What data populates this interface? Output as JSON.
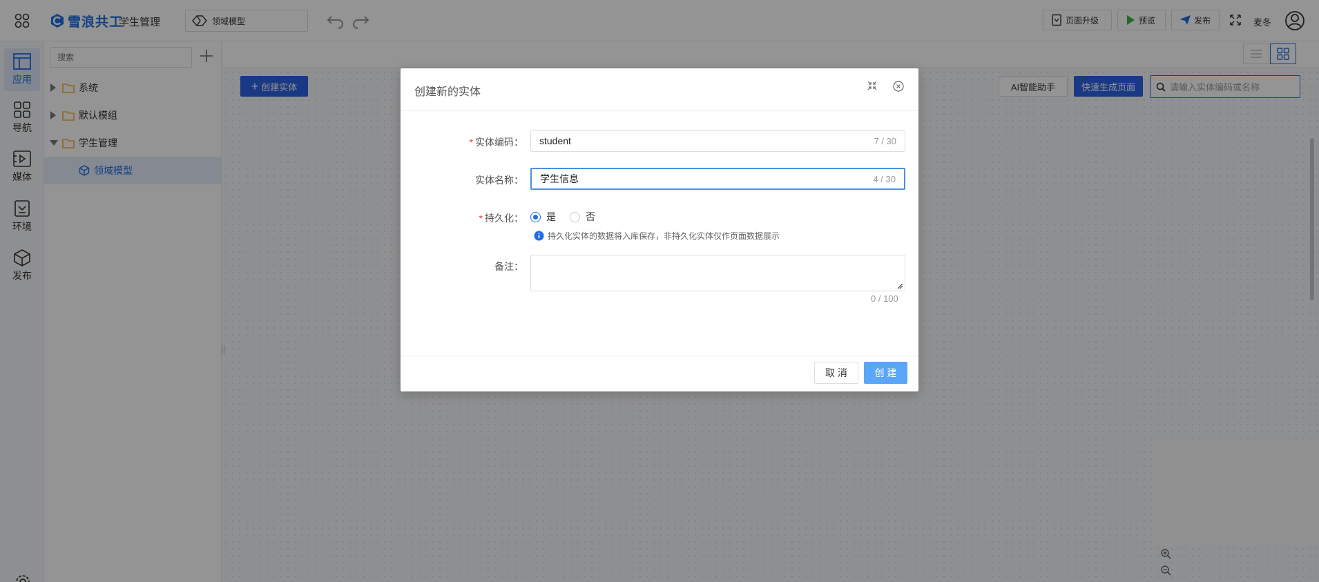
{
  "header": {
    "brand": "雪浪共工",
    "app_name": "学生管理",
    "model_selector": "领域模型",
    "upgrade_label": "页面升级",
    "preview_label": "预览",
    "publish_label": "发布",
    "user_name": "麦冬"
  },
  "leftnav": {
    "items": [
      {
        "label": "应用",
        "icon": "layout-icon"
      },
      {
        "label": "导航",
        "icon": "grid-icon"
      },
      {
        "label": "媒体",
        "icon": "media-icon"
      },
      {
        "label": "环境",
        "icon": "environment-icon"
      },
      {
        "label": "发布",
        "icon": "cube-icon"
      }
    ]
  },
  "tree": {
    "search_placeholder": "搜索",
    "items": [
      {
        "label": "系统"
      },
      {
        "label": "默认模组"
      },
      {
        "label": "学生管理"
      },
      {
        "label": "领域模型"
      }
    ]
  },
  "canvas": {
    "create_entity_label": "创建实体",
    "ai_assistant_label": "AI智能助手",
    "quick_generate_label": "快速生成页面",
    "search_placeholder": "请输入实体编码或名称"
  },
  "modal": {
    "title": "创建新的实体",
    "code_label": "实体编码",
    "code_value": "student",
    "code_count": "7 / 30",
    "name_label": "实体名称",
    "name_value": "学生信息",
    "name_count": "4 / 30",
    "persist_label": "持久化",
    "persist_yes": "是",
    "persist_no": "否",
    "persist_hint": "持久化实体的数据将入库保存，非持久化实体仅作页面数据展示",
    "remark_label": "备注",
    "remark_value": "",
    "remark_count": "0 / 100",
    "cancel_label": "取 消",
    "create_label": "创 建"
  },
  "colors": {
    "primary": "#2d62e3",
    "accent": "#1e6fe0",
    "create_button": "#5aa6f8",
    "required": "#e53935",
    "folder": "#f0b43c"
  }
}
